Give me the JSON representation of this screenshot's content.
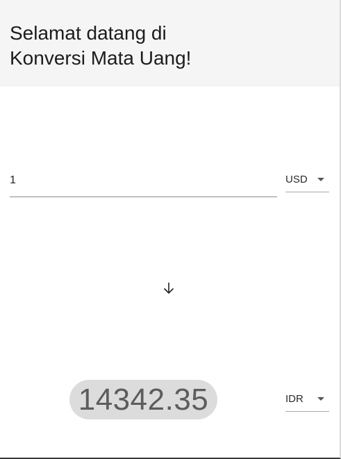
{
  "header": {
    "title": "Selamat datang di\nKonversi Mata Uang!"
  },
  "converter": {
    "amount_value": "1",
    "from_currency": "USD",
    "to_currency": "IDR",
    "result": "14342.35"
  },
  "icons": {
    "swap": "arrow-down-icon",
    "dropdown": "caret-down-icon"
  },
  "colors": {
    "header_bg": "#f5f5f5",
    "result_pill_bg": "#dcdcdc",
    "result_text": "#5d5d5d"
  }
}
